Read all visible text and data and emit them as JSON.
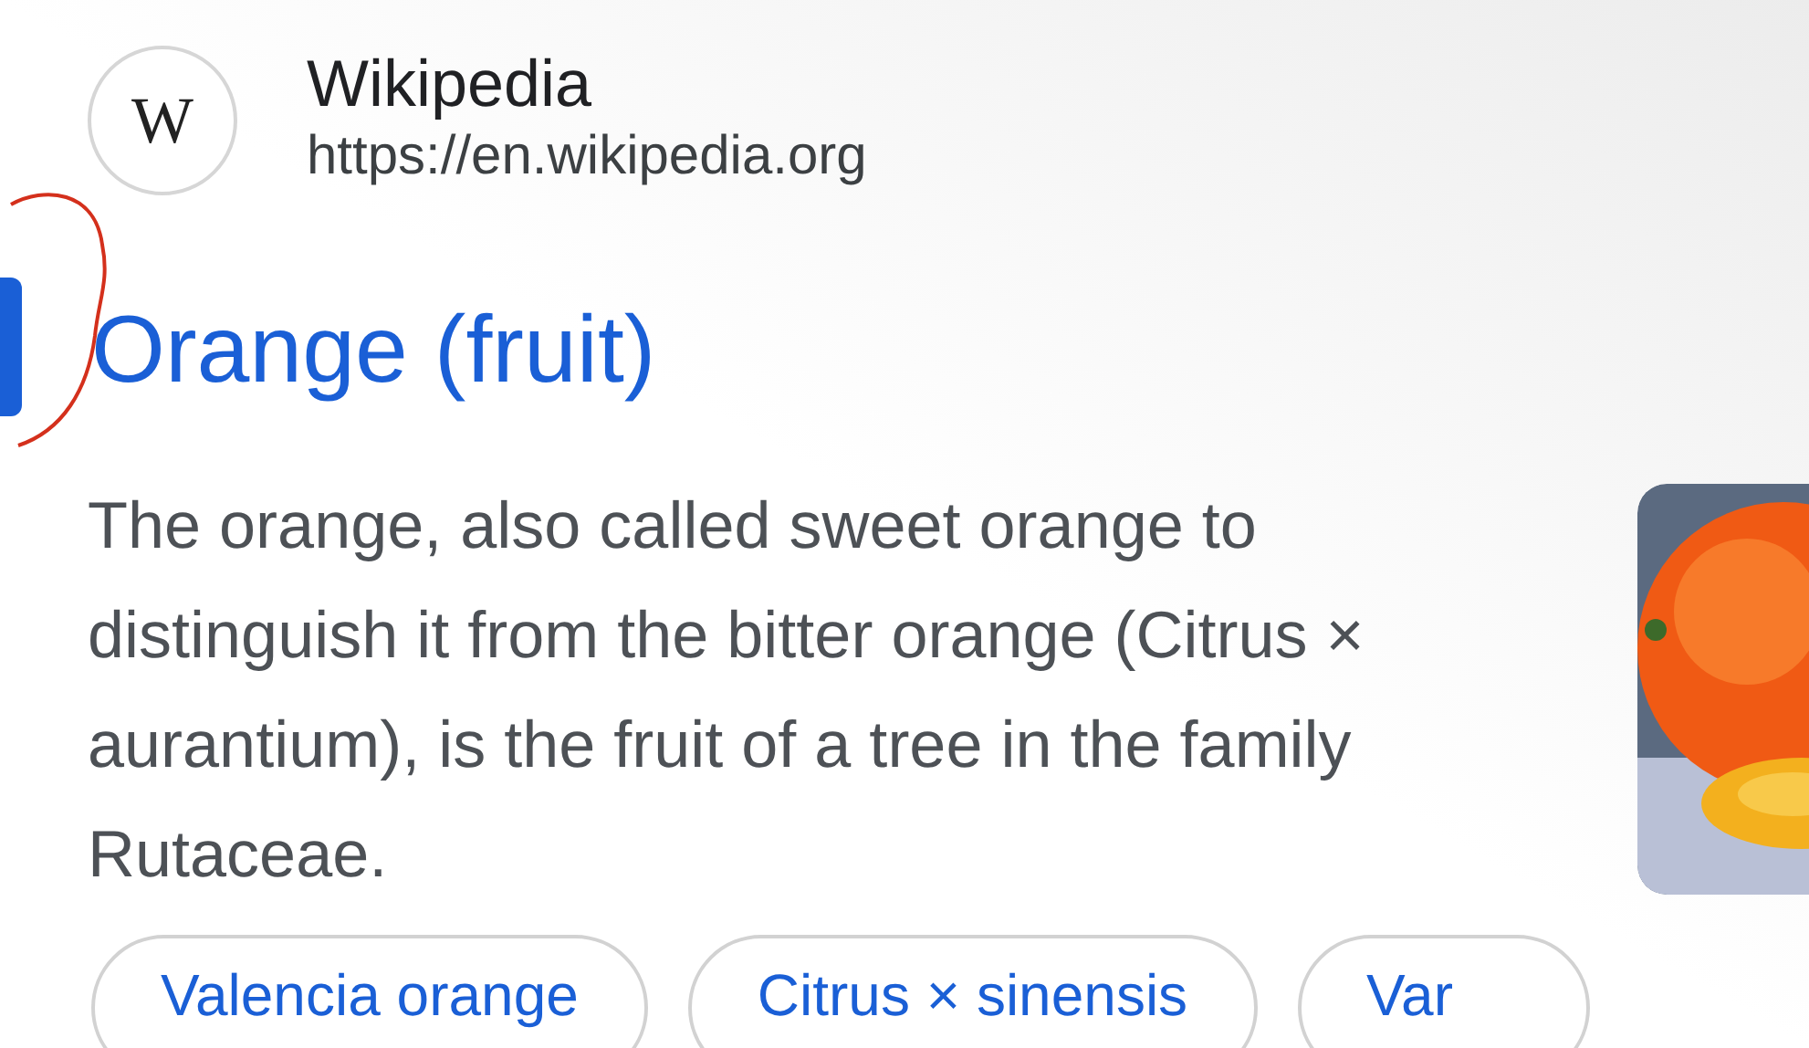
{
  "source": {
    "name": "Wikipedia",
    "url": "https://en.wikipedia.org",
    "logo_letter": "W"
  },
  "result": {
    "title": "Orange (fruit)",
    "snippet": "The orange, also called sweet orange to distinguish it from the bitter orange (Citrus × aurantium), is the fruit of a tree in the family Rutaceae."
  },
  "chips": [
    "Valencia orange",
    "Citrus × sinensis",
    "Var"
  ]
}
